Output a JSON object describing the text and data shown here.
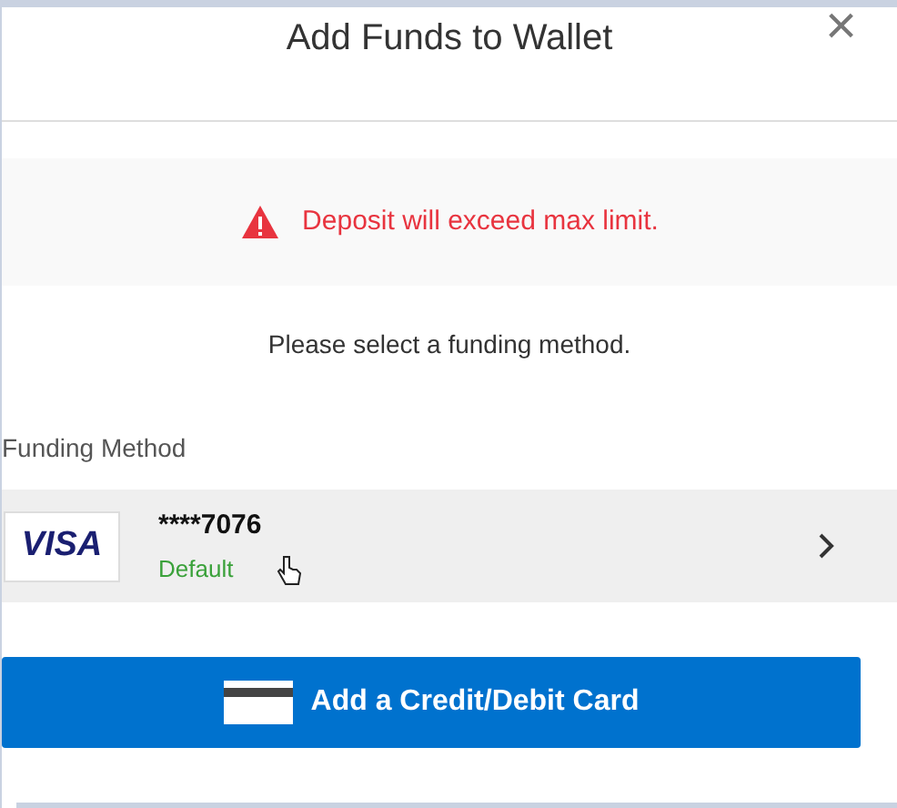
{
  "dialog": {
    "title": "Add Funds to Wallet",
    "close_label": "×"
  },
  "alert": {
    "message": "Deposit will exceed max limit."
  },
  "instruction": "Please select a funding method.",
  "funding_method": {
    "heading": "Funding Method",
    "card": {
      "brand": "VISA",
      "number": "****7076",
      "status": "Default"
    }
  },
  "add_card_button": {
    "label": "Add a Credit/Debit Card"
  }
}
